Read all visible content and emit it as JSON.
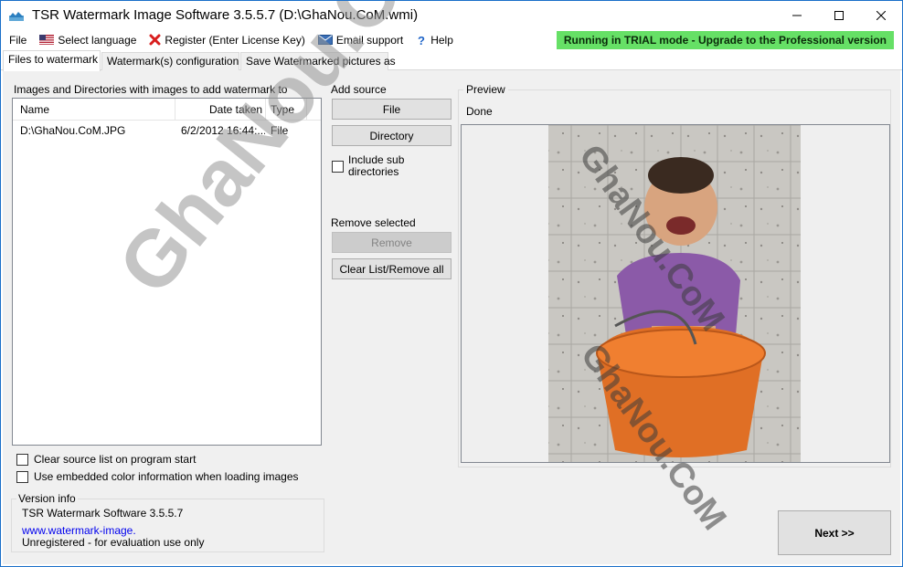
{
  "window": {
    "title": "TSR Watermark Image Software 3.5.5.7 (D:\\GhaNou.CoM.wmi)"
  },
  "menu": {
    "file": "File",
    "select_language": "Select language",
    "register": "Register (Enter License Key)",
    "email_support": "Email support",
    "help": "Help",
    "trial_banner": "Running in TRIAL mode - Upgrade to the Professional version"
  },
  "tabs": [
    {
      "label": "Files to watermark"
    },
    {
      "label": "Watermark(s) configuration"
    },
    {
      "label": "Save Watermarked pictures as"
    }
  ],
  "files_panel": {
    "heading": "Images and Directories with images to add watermark to",
    "columns": [
      "Name",
      "Date taken",
      "Type"
    ],
    "rows": [
      {
        "name": "D:\\GhaNou.CoM.JPG",
        "date": "6/2/2012 16:44:...",
        "type": "File"
      }
    ]
  },
  "add_source": {
    "heading": "Add source",
    "file_button": "File",
    "directory_button": "Directory",
    "include_sub_label": "Include sub\ndirectories",
    "include_sub_checked": false
  },
  "remove_selected": {
    "heading": "Remove selected",
    "remove_button": "Remove",
    "clear_button": "Clear List/Remove all"
  },
  "options": {
    "clear_source_label": "Clear source list on program start",
    "embedded_color_label": "Use embedded color information when loading images",
    "clear_source_checked": false,
    "embedded_color_checked": false
  },
  "version_info": {
    "title": "Version info",
    "version": "TSR Watermark Software 3.5.5.7",
    "link": "www.watermark-image.",
    "status": "Unregistered - for evaluation use only"
  },
  "preview": {
    "title": "Preview",
    "status": "Done"
  },
  "next_button": "Next >>",
  "watermarks": {
    "big": "GhaNou.CoM",
    "small": "GhaNou.CoM"
  },
  "colors": {
    "accent": "#1a6fc9",
    "trial_banner_bg": "#66e066",
    "panel_bg": "#f0f0f0",
    "link": "#0000ee"
  }
}
